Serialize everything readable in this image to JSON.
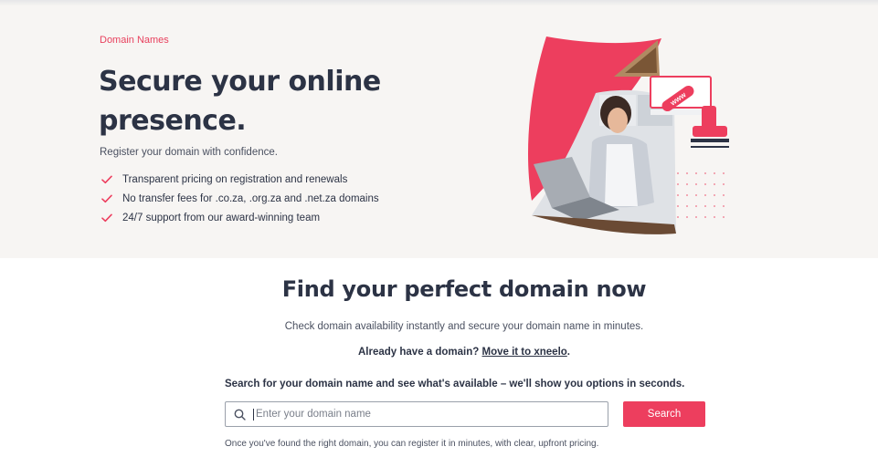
{
  "hero": {
    "eyebrow": "Domain Names",
    "title": "Secure your online presence.",
    "subtitle": "Register your domain with confidence.",
    "features": [
      "Transparent pricing on registration and renewals",
      "No transfer fees for .co.za, .org.za and .net.za domains",
      "24/7 support from our award-winning team"
    ],
    "art_stamp_text": "www"
  },
  "finder": {
    "title": "Find your perfect domain now",
    "subtitle": "Check domain availability instantly and secure your domain name in minutes.",
    "already_prefix": "Already have a domain?",
    "already_link": "Move it to xneelo",
    "already_suffix": ".",
    "search_intro": "Search for your domain name and see what's available – we'll show you options in seconds.",
    "search_placeholder": "Enter your domain name",
    "search_button": "Search",
    "footnote": "Once you've found the right domain, you can register it in minutes, with clear, upfront pricing."
  },
  "colors": {
    "accent": "#ed3e5e",
    "text_dark": "#2c3345",
    "hero_bg": "#f7f5f3"
  },
  "icons": {
    "check": "check-icon",
    "search": "search-icon"
  }
}
